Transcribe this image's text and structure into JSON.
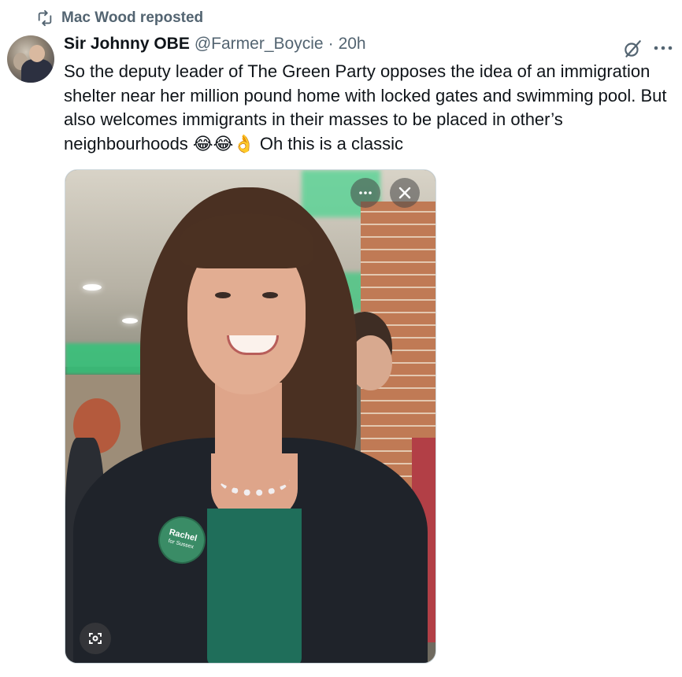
{
  "repost": {
    "icon": "repost-icon",
    "label": "Mac Wood reposted"
  },
  "tweet": {
    "author_name": "Sir Johnny OBE",
    "handle": "@Farmer_Boycie",
    "separator": "·",
    "time": "20h",
    "text": "So the deputy leader of The Green Party opposes the idea of an immigration shelter near her million pound home with locked gates and swimming pool. But also welcomes immigrants in their masses to be placed in other’s neighbourhoods 😂😂👌 Oh this is a classic"
  },
  "media": {
    "badge_text": "Rachel",
    "badge_subtext": "for Sussex",
    "more_icon": "more-icon",
    "close_icon": "close-icon",
    "lens_icon": "visual-search-icon"
  },
  "colors": {
    "text_primary": "#0f1419",
    "text_secondary": "#536471",
    "border": "#cfd9de"
  }
}
